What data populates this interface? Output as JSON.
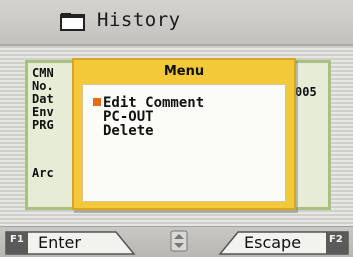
{
  "header": {
    "title": "History",
    "icon": "folder-icon"
  },
  "card": {
    "lines": [
      "CMN",
      "No.",
      "Dat",
      "Env",
      "PRG",
      "Arc"
    ],
    "right_fragment": "005"
  },
  "menu": {
    "title": "Menu",
    "items": [
      {
        "label": "Edit Comment",
        "selected": true
      },
      {
        "label": "PC-OUT",
        "selected": false
      },
      {
        "label": "Delete",
        "selected": false
      }
    ],
    "selected_marker_color": "#e36b1a"
  },
  "footer": {
    "left_key": {
      "fkey": "F1",
      "label": "Enter"
    },
    "center_icon": "up-down-arrows-icon",
    "right_key": {
      "fkey": "F2",
      "label": "Escape"
    }
  },
  "colors": {
    "menu_frame": "#f3c93a",
    "card_border": "#a8c080"
  }
}
